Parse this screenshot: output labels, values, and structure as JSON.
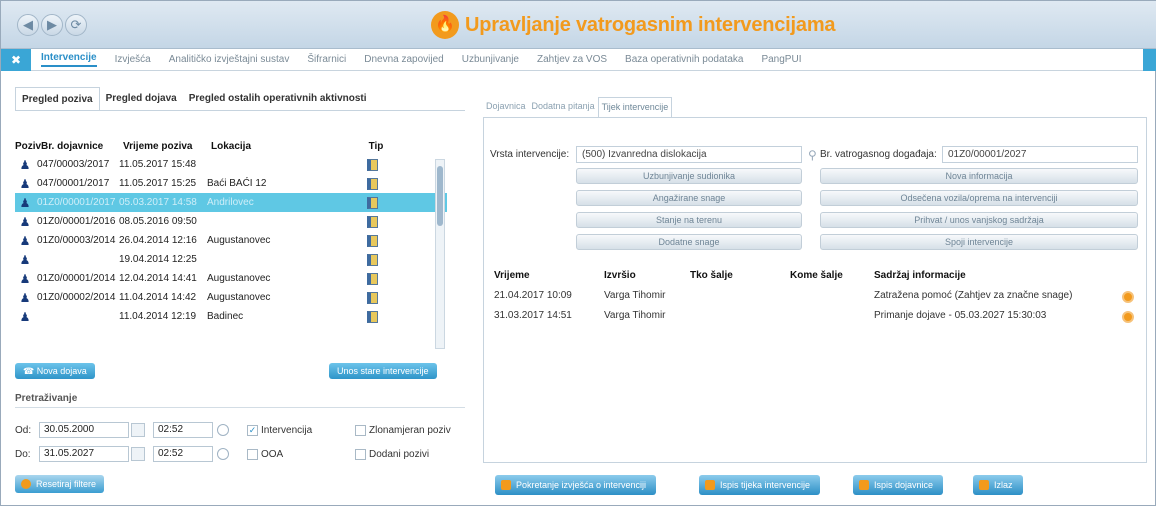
{
  "window": {
    "title": "Upravljanje vatrogasnim intervencijama",
    "nav": [
      "◀",
      "▶",
      "⟳"
    ]
  },
  "menu": {
    "items": [
      "Intervencije",
      "Izvješća",
      "Analitičko izvještajni sustav",
      "Šifrarnici",
      "Dnevna zapovijed",
      "Uzbunjivanje",
      "Zahtjev za VOS",
      "Baza operativnih podataka",
      "PangPUI"
    ]
  },
  "left": {
    "tabs": [
      "Pregled poziva",
      "Pregled dojava",
      "Pregled ostalih operativnih aktivnosti"
    ],
    "columns": [
      "Poziv",
      "Br. dojavnice",
      "Vrijeme poziva",
      "Lokacija",
      "Tip"
    ],
    "rows": [
      {
        "br": "047/00003/2017",
        "vrijeme": "11.05.2017 15:48",
        "lokacija": ""
      },
      {
        "br": "047/00001/2017",
        "vrijeme": "11.05.2017 15:25",
        "lokacija": "Baći BAĆI 12"
      },
      {
        "br": "01Z0/00001/2017",
        "vrijeme": "05.03.2017 14:58",
        "lokacija": "Andrilovec"
      },
      {
        "br": "01Z0/00001/2016",
        "vrijeme": "08.05.2016 09:50",
        "lokacija": ""
      },
      {
        "br": "01Z0/00003/2014",
        "vrijeme": "26.04.2014 12:16",
        "lokacija": "Augustanovec"
      },
      {
        "br": "",
        "vrijeme": "19.04.2014 12:25",
        "lokacija": ""
      },
      {
        "br": "01Z0/00001/2014",
        "vrijeme": "12.04.2014 14:41",
        "lokacija": "Augustanovec"
      },
      {
        "br": "01Z0/00002/2014",
        "vrijeme": "11.04.2014 14:42",
        "lokacija": "Augustanovec"
      },
      {
        "br": "",
        "vrijeme": "11.04.2014 12:19",
        "lokacija": "Badinec"
      }
    ],
    "btn_nova": "Nova dojava",
    "btn_unos": "Unos stare intervencije",
    "search_label": "Pretraživanje",
    "od_label": "Od:",
    "do_label": "Do:",
    "od_date": "30.05.2000",
    "od_time": "02:52",
    "do_date": "31.05.2027",
    "do_time": "02:52",
    "chk_intervencija": "Intervencija",
    "chk_ooa": "OOA",
    "chk_zlonamjeran": "Zlonamjeran poziv",
    "chk_dodani": "Dodani pozivi",
    "btn_resetiraj": "Resetiraj filtere"
  },
  "right": {
    "tabs": [
      "Dojavnica",
      "Dodatna pitanja",
      "Tijek intervencije"
    ],
    "vrsta_label": "Vrsta intervencije:",
    "vrsta_value": "(500) Izvanredna dislokacija",
    "br_label": "Br. vatrogasnog događaja:",
    "br_value": "01Z0/00001/2027",
    "buttons_left": [
      "Uzbunjivanje sudionika",
      "Angažirane snage",
      "Stanje na terenu",
      "Dodatne snage"
    ],
    "buttons_right": [
      "Nova informacija",
      "Odsečena vozila/oprema na intervenciji",
      "Prihvat / unos vanjskog sadržaja",
      "Spoji intervencije"
    ],
    "columns": [
      "Vrijeme",
      "Izvršio",
      "Tko šalje",
      "Kome šalje",
      "Sadržaj informacije"
    ],
    "rows": [
      {
        "vrijeme": "21.04.2017 10:09",
        "izvrsio": "Varga Tihomir",
        "sadrzaj": "Zatražena pomoć (Zahtjev za značne snage)"
      },
      {
        "vrijeme": "31.03.2017 14:51",
        "izvrsio": "Varga Tihomir",
        "sadrzaj": "Primanje dojave - 05.03.2027 15:30:03"
      }
    ]
  },
  "bottom_buttons": [
    "Pokretanje izvješća o intervenciji",
    "Ispis tijeka intervencije",
    "Ispis dojavnice",
    "Izlaz"
  ]
}
